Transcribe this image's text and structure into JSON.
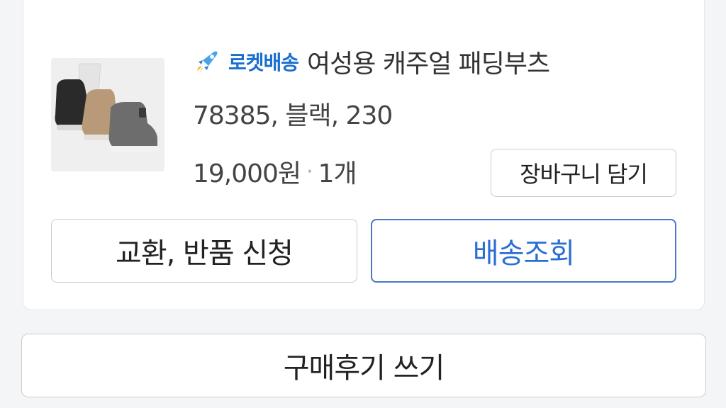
{
  "product": {
    "badge_label": "로켓배송",
    "badge_icon": "rocket-icon",
    "name": "여성용 캐주얼 패딩부츠",
    "option": "78385, 블랙, 230",
    "price": "19,000원",
    "separator": "·",
    "quantity": "1개",
    "image_icon": "boots-product-image"
  },
  "actions": {
    "cart_label": "장바구니 담기",
    "return_label": "교환, 반품 신청",
    "tracking_label": "배송조회",
    "review_label": "구매후기 쓰기"
  },
  "colors": {
    "rocket_blue": "#1a6ecf",
    "tracking_border": "#4a78c4"
  }
}
